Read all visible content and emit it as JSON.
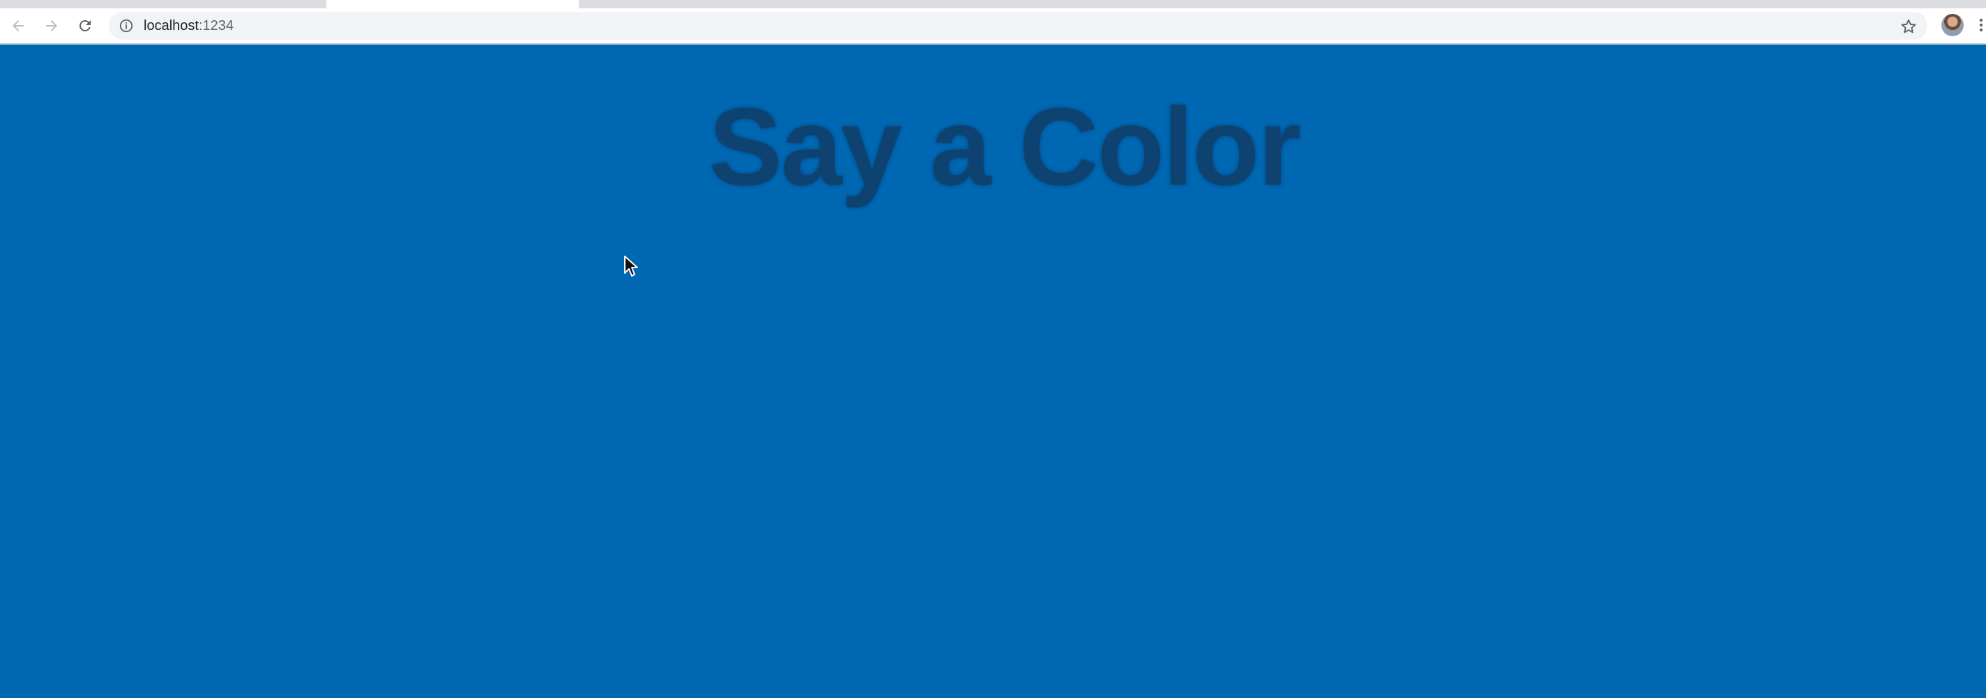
{
  "browser": {
    "url_host": "localhost",
    "url_port": ":1234",
    "back_icon": "arrow-left-icon",
    "forward_icon": "arrow-right-icon",
    "reload_icon": "reload-icon",
    "site_info_icon": "info-icon",
    "bookmark_icon": "star-icon",
    "menu_icon": "kebab-menu-icon"
  },
  "page": {
    "title": "Say a Color",
    "background_color": "#0067b3",
    "title_color": "#10406a"
  }
}
